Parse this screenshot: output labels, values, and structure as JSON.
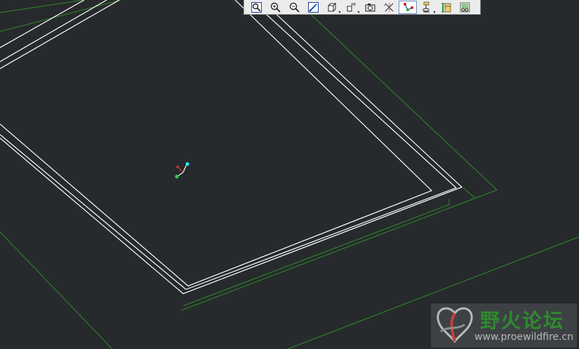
{
  "toolbar": {
    "buttons": [
      {
        "name": "refit-icon",
        "active": false
      },
      {
        "name": "zoom-in-icon",
        "active": false
      },
      {
        "name": "zoom-out-icon",
        "active": false
      },
      {
        "name": "repaint-icon",
        "active": false
      },
      {
        "name": "display-style-icon",
        "active": false,
        "dropdown": true
      },
      {
        "name": "saved-views-icon",
        "active": false,
        "dropdown": true
      },
      {
        "name": "view-manager-icon",
        "active": false
      },
      {
        "name": "datum-planes-icon",
        "active": false
      },
      {
        "name": "datum-axes-icon",
        "active": true
      },
      {
        "name": "datum-points-icon",
        "active": false,
        "dropdown": true
      },
      {
        "name": "coordinate-systems-icon",
        "active": false
      },
      {
        "name": "annotations-icon",
        "active": false
      }
    ]
  },
  "watermark": {
    "title": "野火论坛",
    "url": "www.proewildfire.cn"
  },
  "colors": {
    "background": "#272a2c",
    "edge_white": "#ffffff",
    "edge_green": "#2e8b2e",
    "axis_red": "#e03030",
    "axis_green": "#2fd34d",
    "axis_cyan": "#33e0ff"
  }
}
